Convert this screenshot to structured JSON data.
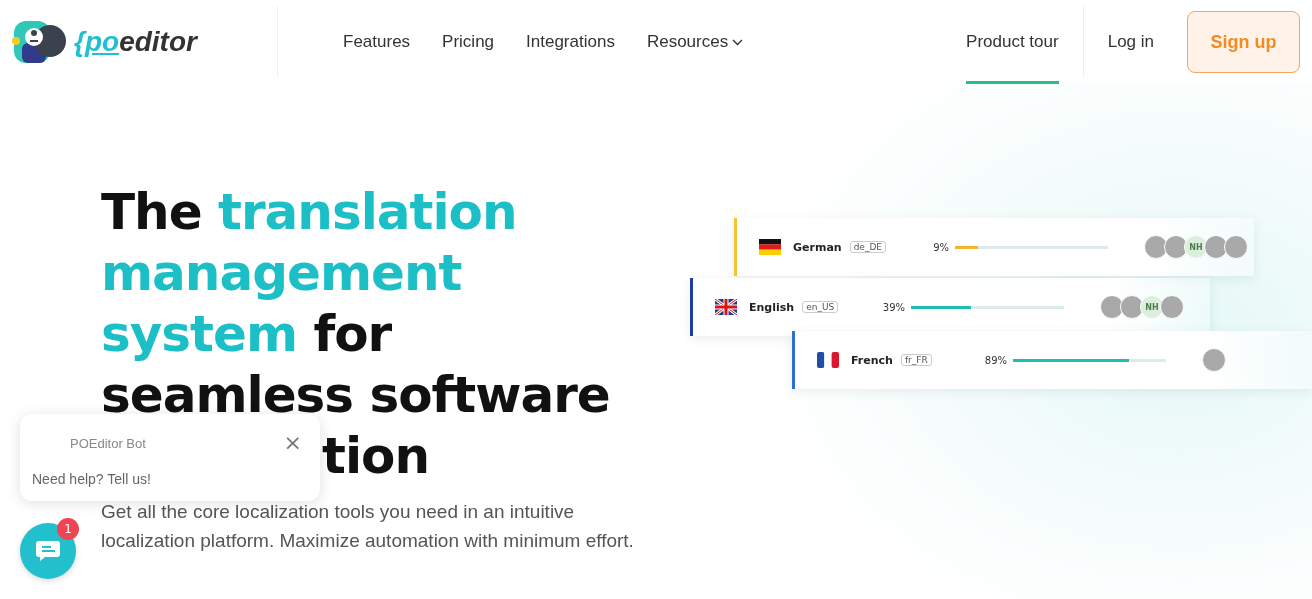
{
  "header": {
    "logo": {
      "brace": "{",
      "po": "po",
      "editor": "editor"
    },
    "nav": [
      {
        "label": "Features",
        "dropdown": false
      },
      {
        "label": "Pricing",
        "dropdown": false
      },
      {
        "label": "Integrations",
        "dropdown": false
      },
      {
        "label": "Resources",
        "dropdown": true
      }
    ],
    "right_nav": [
      {
        "label": "Product tour",
        "selected": true
      },
      {
        "label": "Log in",
        "selected": false
      }
    ],
    "signup": "Sign up"
  },
  "hero": {
    "heading": [
      {
        "text": "The ",
        "accent": false
      },
      {
        "text": "translation management system",
        "accent": true
      },
      {
        "text": " for seamless software",
        "accent": false
      }
    ],
    "heading_tail": "tion",
    "paragraph": "Get all the core localization tools you need in an intuitive localization platform. Maximize automation with minimum effort."
  },
  "languages": [
    {
      "name": "German",
      "code": "de_DE",
      "kind": "de",
      "percent": "9%",
      "level": 0.15,
      "color": "#f5b52a",
      "avatars": [
        {
          "kind": "photo"
        },
        {
          "kind": "photo"
        },
        {
          "kind": "initials",
          "text": "NH"
        },
        {
          "kind": "photo"
        },
        {
          "kind": "photo"
        }
      ]
    },
    {
      "name": "English",
      "code": "en_US",
      "kind": "gb",
      "percent": "39%",
      "level": 0.39,
      "color": "#1dbfb3",
      "avatars": [
        {
          "kind": "photo"
        },
        {
          "kind": "photo"
        },
        {
          "kind": "initials",
          "text": "NH"
        },
        {
          "kind": "photo"
        }
      ]
    },
    {
      "name": "French",
      "code": "fr_FR",
      "kind": "fr",
      "percent": "89%",
      "level": 0.76,
      "color": "#1dbfb3",
      "avatars": [
        {
          "kind": "photo"
        }
      ]
    }
  ],
  "chat": {
    "bot_name": "POEditor Bot",
    "message": "Need help? Tell us!",
    "close": "×",
    "badge": "1"
  }
}
